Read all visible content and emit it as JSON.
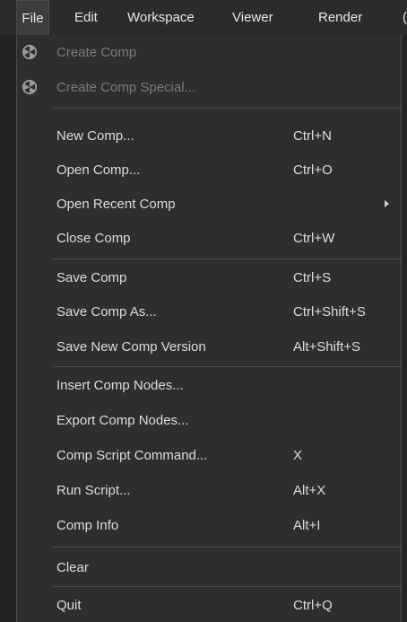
{
  "menubar": {
    "items": [
      "File",
      "Edit",
      "Workspace",
      "Viewer",
      "Render",
      "("
    ]
  },
  "file_menu": {
    "create_comp": "Create Comp",
    "create_comp_special": "Create Comp Special...",
    "new_comp": "New Comp...",
    "new_comp_sc": "Ctrl+N",
    "open_comp": "Open Comp...",
    "open_comp_sc": "Ctrl+O",
    "open_recent": "Open Recent Comp",
    "close_comp": "Close Comp",
    "close_comp_sc": "Ctrl+W",
    "save_comp": "Save Comp",
    "save_comp_sc": "Ctrl+S",
    "save_as": "Save Comp As...",
    "save_as_sc": "Ctrl+Shift+S",
    "save_new_version": "Save New Comp Version",
    "save_new_version_sc": "Alt+Shift+S",
    "insert_nodes": "Insert Comp Nodes...",
    "export_nodes": "Export Comp Nodes...",
    "script_command": "Comp Script Command...",
    "script_command_sc": "X",
    "run_script": "Run Script...",
    "run_script_sc": "Alt+X",
    "comp_info": "Comp Info",
    "comp_info_sc": "Alt+I",
    "clear": "Clear",
    "quit": "Quit",
    "quit_sc": "Ctrl+Q"
  },
  "icons": {
    "create_comp": "fusion-icon",
    "open_recent_submenu": "chevron-right-icon"
  },
  "colors": {
    "menu_bg": "#2e2e2e",
    "menubar_bg": "#2b2b2b",
    "active_bg": "#3d3d3d",
    "text": "#dcdcdc",
    "disabled_text": "#7a7a7a"
  }
}
